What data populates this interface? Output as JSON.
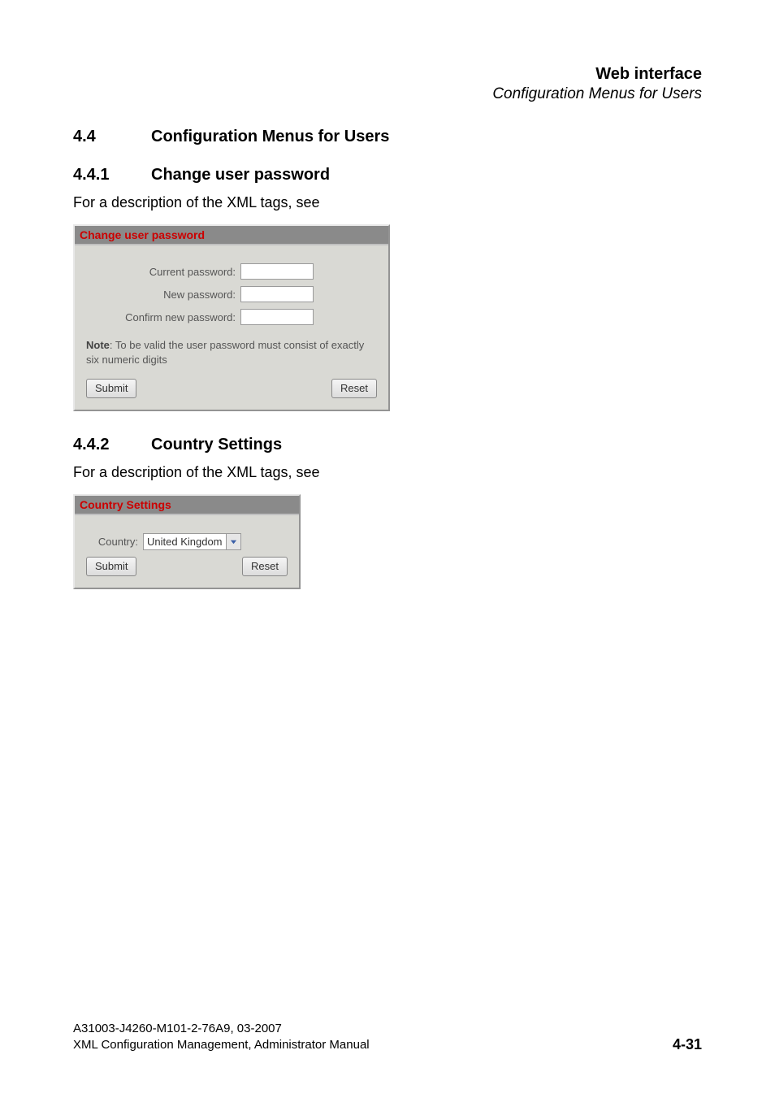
{
  "header": {
    "title": "Web interface",
    "subtitle": "Configuration Menus for Users"
  },
  "section": {
    "number": "4.4",
    "title": "Configuration Menus for Users"
  },
  "subsection1": {
    "number": "4.4.1",
    "title": "Change user password",
    "intro": "For a description of the XML tags, see",
    "panel_title": "Change user password",
    "labels": {
      "current": "Current password:",
      "new": "New password:",
      "confirm": "Confirm new password:"
    },
    "note_bold": "Note",
    "note_rest": ": To be valid the user password must consist of exactly six numeric digits",
    "submit": "Submit",
    "reset": "Reset"
  },
  "subsection2": {
    "number": "4.4.2",
    "title": "Country Settings",
    "intro": "For a description of the XML tags, see",
    "panel_title": "Country Settings",
    "country_label": "Country:",
    "country_value": "United Kingdom",
    "submit": "Submit",
    "reset": "Reset"
  },
  "footer": {
    "line1": "A31003-J4260-M101-2-76A9, 03-2007",
    "line2": "XML Configuration Management, Administrator Manual",
    "page": "4-31"
  }
}
